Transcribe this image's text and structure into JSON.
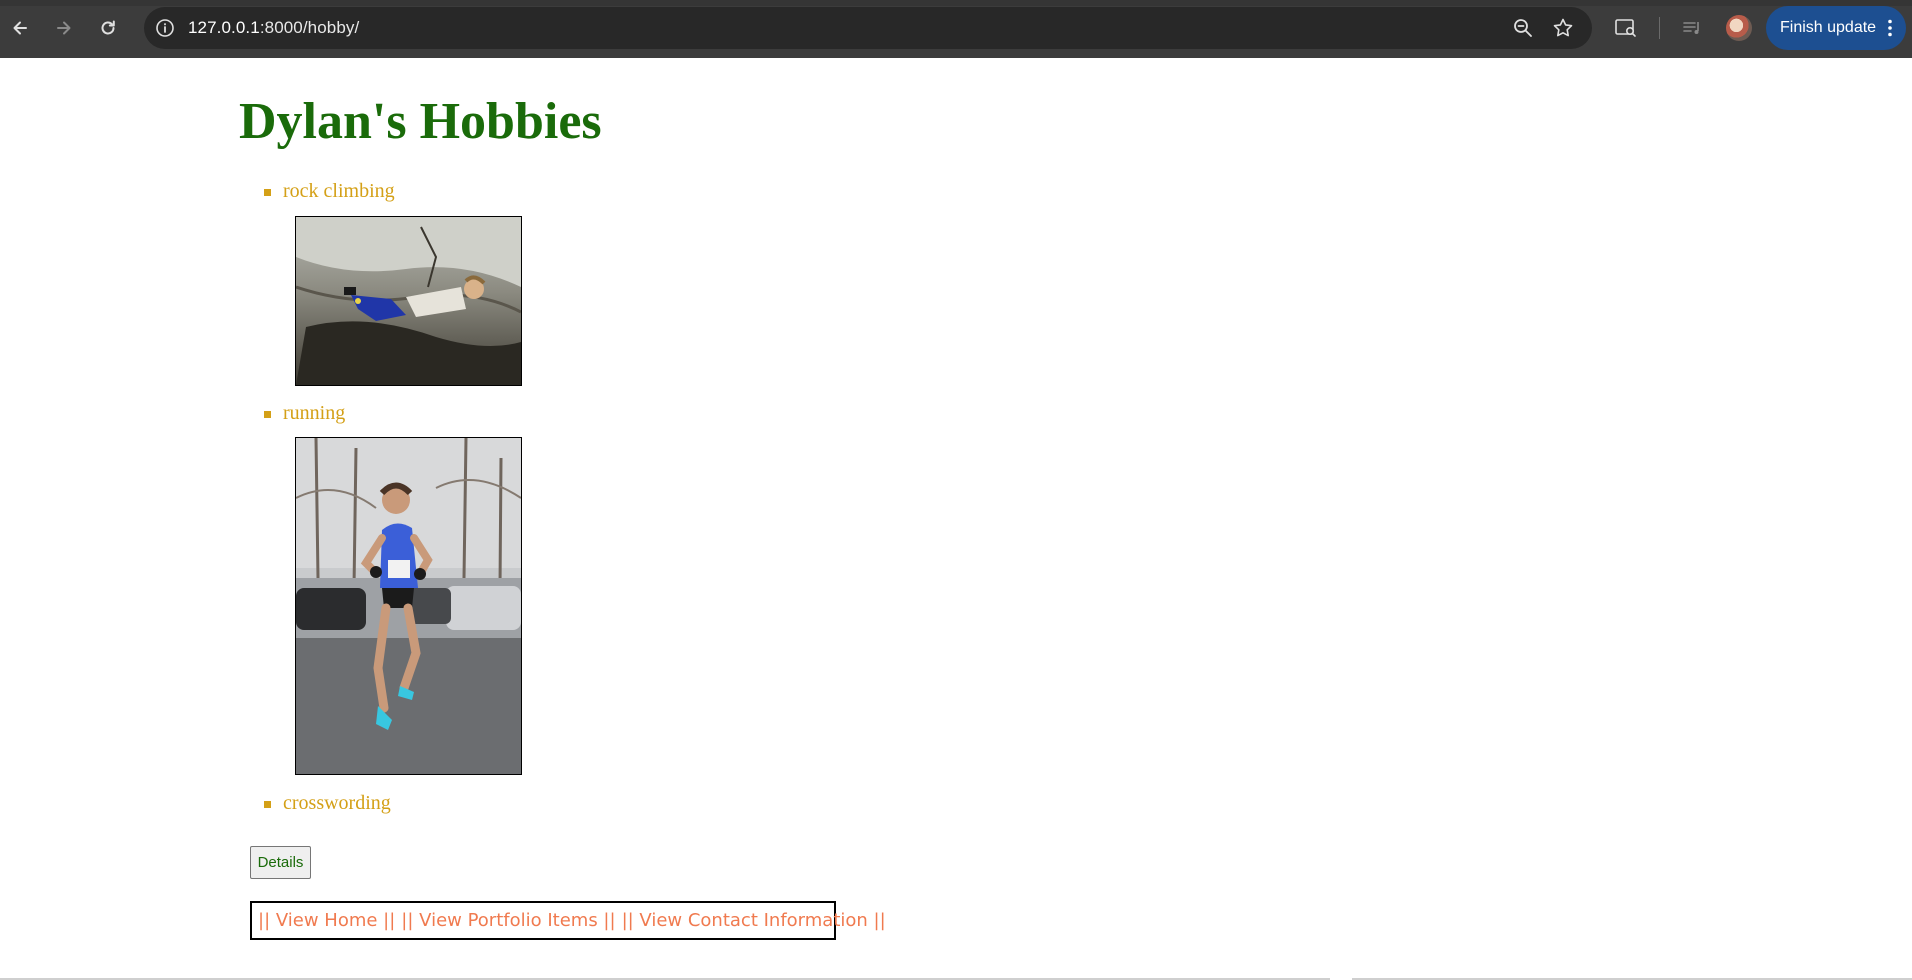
{
  "browser": {
    "url_host": "127.0.0.1",
    "url_rest": ":8000/hobby/",
    "update_label": "Finish update"
  },
  "page": {
    "title": "Dylan's Hobbies",
    "hobbies": [
      {
        "label": "rock climbing",
        "has_image": true
      },
      {
        "label": "running",
        "has_image": true
      },
      {
        "label": "crosswording",
        "has_image": false
      }
    ],
    "details_button": "Details",
    "nav_links": [
      "|| View Home ||",
      "|| View Portfolio Items ||",
      "|| View Contact Information ||"
    ],
    "colors": {
      "title": "#1a6b0a",
      "hobby": "#d4a017",
      "nav_link": "#f07a4f",
      "update_button": "#1d4f91"
    }
  }
}
